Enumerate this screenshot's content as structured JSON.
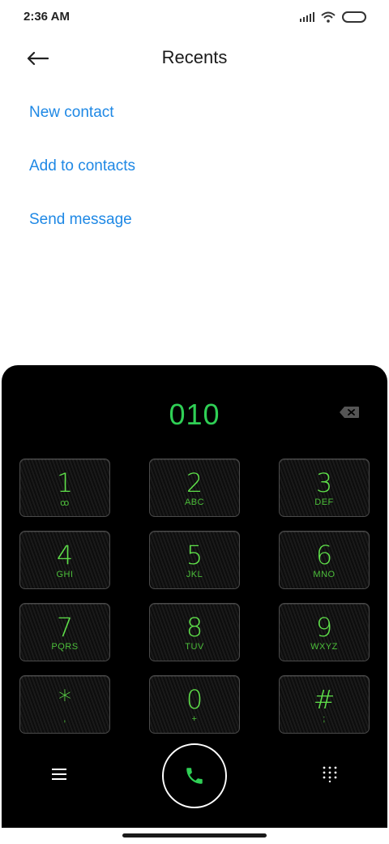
{
  "status_bar": {
    "time": "2:36 AM",
    "icons": [
      "signal-icon",
      "wifi-icon",
      "battery-icon"
    ]
  },
  "header": {
    "title": "Recents",
    "back_icon": "back-arrow-icon"
  },
  "actions": {
    "new_contact": "New contact",
    "add_to_contacts": "Add to contacts",
    "send_message": "Send message",
    "link_color": "#1e88e5"
  },
  "dialer": {
    "number": "010",
    "accent_color": "#2fcf55",
    "backspace_icon": "backspace-icon",
    "keys": [
      {
        "digit": "1",
        "letters": "ꝏ"
      },
      {
        "digit": "2",
        "letters": "ABC"
      },
      {
        "digit": "3",
        "letters": "DEF"
      },
      {
        "digit": "4",
        "letters": "GHI"
      },
      {
        "digit": "5",
        "letters": "JKL"
      },
      {
        "digit": "6",
        "letters": "MNO"
      },
      {
        "digit": "7",
        "letters": "PQRS"
      },
      {
        "digit": "8",
        "letters": "TUV"
      },
      {
        "digit": "9",
        "letters": "WXYZ"
      },
      {
        "digit": "*",
        "letters": ","
      },
      {
        "digit": "0",
        "letters": "+"
      },
      {
        "digit": "#",
        "letters": ";"
      }
    ],
    "bottom": {
      "menu_icon": "menu-icon",
      "call_icon": "phone-icon",
      "keypad_icon": "dialpad-icon"
    }
  }
}
